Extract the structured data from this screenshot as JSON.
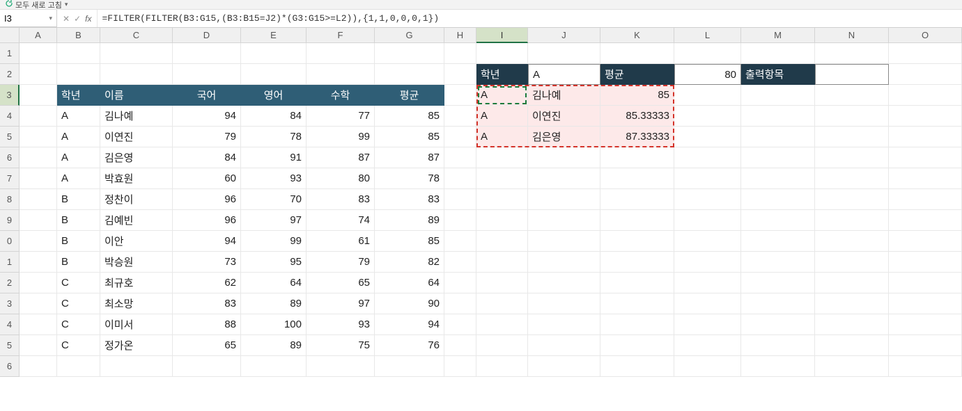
{
  "ribbon": {
    "refresh_label": "모두 새로 고침"
  },
  "name_box": {
    "value": "I3"
  },
  "formula_bar": {
    "cancel": "✕",
    "enter": "✓",
    "fx": "fx",
    "formula": "=FILTER(FILTER(B3:G15,(B3:B15=J2)*(G3:G15>=L2)),{1,1,0,0,0,1})"
  },
  "columns": [
    "A",
    "B",
    "C",
    "D",
    "E",
    "F",
    "G",
    "H",
    "I",
    "J",
    "K",
    "L",
    "M",
    "N",
    "O"
  ],
  "row_labels": [
    "1",
    "2",
    "3",
    "4",
    "5",
    "6",
    "7",
    "8",
    "9",
    "0",
    "1",
    "2",
    "3",
    "4",
    "5",
    "6"
  ],
  "main_headers": {
    "b": "학년",
    "c": "이름",
    "d": "국어",
    "e": "영어",
    "f": "수학",
    "g": "평균"
  },
  "criteria_headers": {
    "i": "학년",
    "k": "평균",
    "m": "출력항목"
  },
  "criteria_values": {
    "j": "A",
    "l": "80"
  },
  "main_data": [
    {
      "b": "A",
      "c": "김나예",
      "d": 94,
      "e": 84,
      "f": 77,
      "g": 85
    },
    {
      "b": "A",
      "c": "이연진",
      "d": 79,
      "e": 78,
      "f": 99,
      "g": 85
    },
    {
      "b": "A",
      "c": "김은영",
      "d": 84,
      "e": 91,
      "f": 87,
      "g": 87
    },
    {
      "b": "A",
      "c": "박효원",
      "d": 60,
      "e": 93,
      "f": 80,
      "g": 78
    },
    {
      "b": "B",
      "c": "정찬이",
      "d": 96,
      "e": 70,
      "f": 83,
      "g": 83
    },
    {
      "b": "B",
      "c": "김예빈",
      "d": 96,
      "e": 97,
      "f": 74,
      "g": 89
    },
    {
      "b": "B",
      "c": "이안",
      "d": 94,
      "e": 99,
      "f": 61,
      "g": 85
    },
    {
      "b": "B",
      "c": "박승원",
      "d": 73,
      "e": 95,
      "f": 79,
      "g": 82
    },
    {
      "b": "C",
      "c": "최규호",
      "d": 62,
      "e": 64,
      "f": 65,
      "g": 64
    },
    {
      "b": "C",
      "c": "최소망",
      "d": 83,
      "e": 89,
      "f": 97,
      "g": 90
    },
    {
      "b": "C",
      "c": "이미서",
      "d": 88,
      "e": 100,
      "f": 93,
      "g": 94
    },
    {
      "b": "C",
      "c": "정가온",
      "d": 65,
      "e": 89,
      "f": 75,
      "g": 76
    }
  ],
  "spill_result": [
    {
      "i": "A",
      "j": "김나예",
      "k": "85"
    },
    {
      "i": "A",
      "j": "이연진",
      "k": "85.33333"
    },
    {
      "i": "A",
      "j": "김은영",
      "k": "87.33333"
    }
  ]
}
